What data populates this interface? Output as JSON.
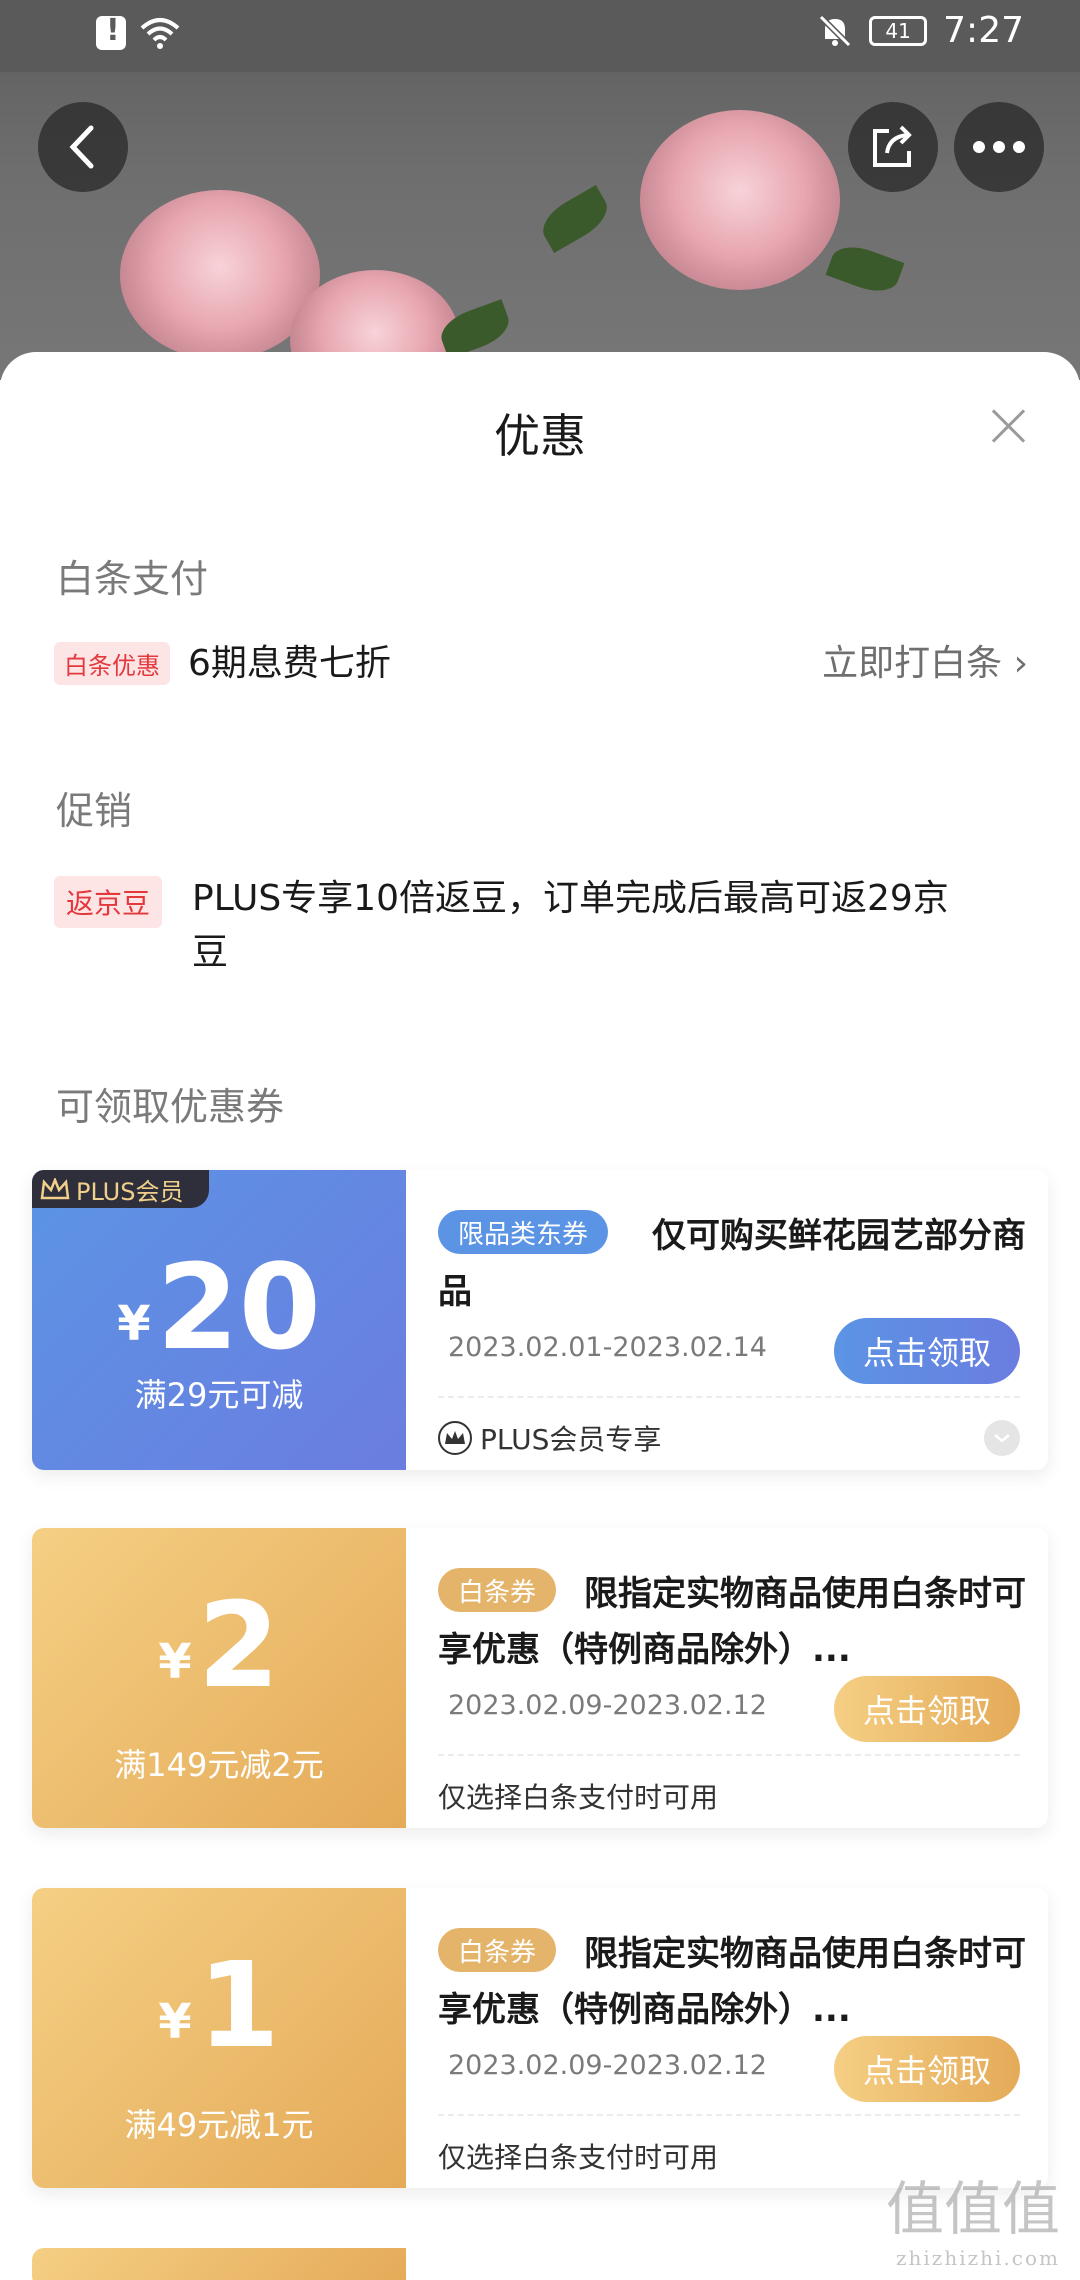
{
  "status_bar": {
    "time": "7:27",
    "battery": "41"
  },
  "sheet": {
    "title": "优惠"
  },
  "baitiao_pay": {
    "section_title": "白条支付",
    "tag": "白条优惠",
    "text": "6期息费七折",
    "link": "立即打白条 ›"
  },
  "promotion": {
    "section_title": "促销",
    "tag": "返京豆",
    "text_line1": "PLUS专享10倍返豆，订单完成后最高可返29京",
    "text_line2": "豆"
  },
  "coupons_section": {
    "title": "可领取优惠券"
  },
  "coupons": [
    {
      "badge": "PLUS会员",
      "currency": "¥",
      "amount": "20",
      "condition": "满29元可减",
      "tag": "限品类东券",
      "description": "仅可购买鲜花园艺部分商品",
      "date_range": "2023.02.01-2023.02.14",
      "button": "点击领取",
      "note": "PLUS会员专享"
    },
    {
      "currency": "¥",
      "amount": "2",
      "condition": "满149元减2元",
      "tag": "白条券",
      "description": "限指定实物商品使用白条时可享优惠（特例商品除外）...",
      "date_range": "2023.02.09-2023.02.12",
      "button": "点击领取",
      "note": "仅选择白条支付时可用"
    },
    {
      "currency": "¥",
      "amount": "1",
      "condition": "满49元减1元",
      "tag": "白条券",
      "description": "限指定实物商品使用白条时可享优惠（特例商品除外）...",
      "date_range": "2023.02.09-2023.02.12",
      "button": "点击领取",
      "note": "仅选择白条支付时可用"
    }
  ],
  "watermark": {
    "text": "值值值",
    "subtext": "zhizhizhi.com"
  },
  "colors": {
    "jd_red": "#e4393c",
    "plus_blue": "#5b94e4",
    "baitiao_gold": "#e4aa58"
  }
}
